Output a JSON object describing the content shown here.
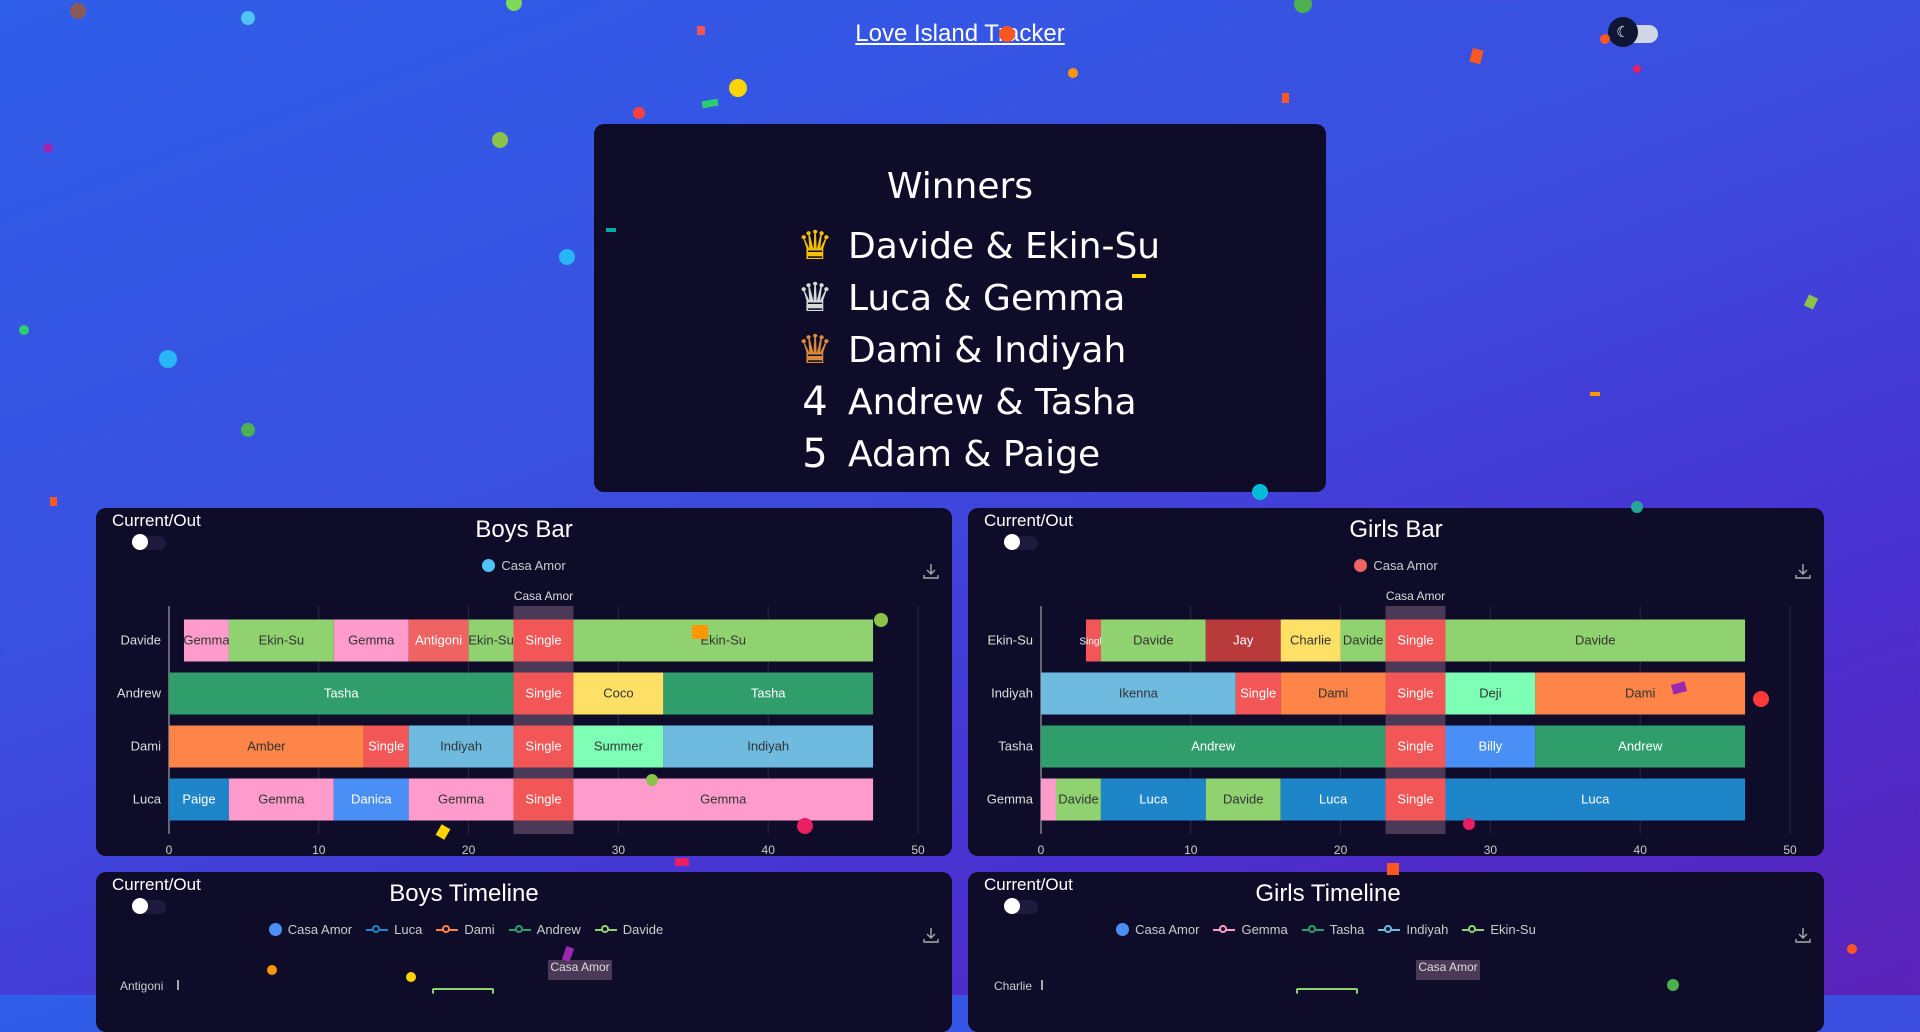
{
  "header": {
    "title": "Love Island Tracker"
  },
  "winners": {
    "title": "Winners",
    "rows": [
      {
        "rank": "♛",
        "color": "#f6c000",
        "names": "Davide & Ekin-Su"
      },
      {
        "rank": "♛",
        "color": "#d9d9d9",
        "names": "Luca & Gemma"
      },
      {
        "rank": "♛",
        "color": "#d98b3a",
        "names": "Dami & Indiyah"
      },
      {
        "rank": "4",
        "color": "#ffffff",
        "names": "Andrew & Tasha"
      },
      {
        "rank": "5",
        "color": "#ffffff",
        "names": "Adam & Paige"
      }
    ]
  },
  "boys_bar": {
    "title": "Boys Bar",
    "toggle_label": "Current/Out",
    "legend": {
      "label": "Casa Amor",
      "color": "#4fc3f7"
    },
    "casa_label": "Casa Amor",
    "chart_data": {
      "type": "bar",
      "orientation": "horizontal-stacked",
      "xlim": [
        0,
        50
      ],
      "ticks": [
        0,
        10,
        20,
        30,
        40,
        50
      ],
      "casa_amor": [
        23,
        27
      ],
      "rows": [
        {
          "name": "Davide",
          "segments": [
            {
              "label": "Gemma",
              "start": 1,
              "end": 4,
              "color": "#ff9ccc"
            },
            {
              "label": "Ekin-Su",
              "start": 4,
              "end": 11,
              "color": "#8fd26f"
            },
            {
              "label": "Gemma",
              "start": 11,
              "end": 16,
              "color": "#ff9ccc"
            },
            {
              "label": "Antigoni",
              "start": 16,
              "end": 20,
              "color": "#f06363"
            },
            {
              "label": "Ekin-Su",
              "start": 20,
              "end": 23,
              "color": "#8fd26f"
            },
            {
              "label": "Single",
              "start": 23,
              "end": 27,
              "color": "#f25656"
            },
            {
              "label": "Ekin-Su",
              "start": 27,
              "end": 47,
              "color": "#8fd26f"
            }
          ]
        },
        {
          "name": "Andrew",
          "segments": [
            {
              "label": "Tasha",
              "start": 0,
              "end": 23,
              "color": "#2f9e6b"
            },
            {
              "label": "Single",
              "start": 23,
              "end": 27,
              "color": "#f25656"
            },
            {
              "label": "Coco",
              "start": 27,
              "end": 33,
              "color": "#ffe066"
            },
            {
              "label": "Tasha",
              "start": 33,
              "end": 47,
              "color": "#2f9e6b"
            }
          ]
        },
        {
          "name": "Dami",
          "segments": [
            {
              "label": "Amber",
              "start": 0,
              "end": 13,
              "color": "#ff8447"
            },
            {
              "label": "Single",
              "start": 13,
              "end": 16,
              "color": "#f25656"
            },
            {
              "label": "Indiyah",
              "start": 16,
              "end": 23,
              "color": "#6fbbe0"
            },
            {
              "label": "Single",
              "start": 23,
              "end": 27,
              "color": "#f25656"
            },
            {
              "label": "Summer",
              "start": 27,
              "end": 33,
              "color": "#7dffb5"
            },
            {
              "label": "Indiyah",
              "start": 33,
              "end": 47,
              "color": "#6fbbe0"
            }
          ]
        },
        {
          "name": "Luca",
          "segments": [
            {
              "label": "Paige",
              "start": 0,
              "end": 4,
              "color": "#1e86c8"
            },
            {
              "label": "Gemma",
              "start": 4,
              "end": 11,
              "color": "#ff9ccc"
            },
            {
              "label": "Danica",
              "start": 11,
              "end": 16,
              "color": "#4a8ff5"
            },
            {
              "label": "Gemma",
              "start": 16,
              "end": 23,
              "color": "#ff9ccc"
            },
            {
              "label": "Single",
              "start": 23,
              "end": 27,
              "color": "#f25656"
            },
            {
              "label": "Gemma",
              "start": 27,
              "end": 47,
              "color": "#ff9ccc"
            }
          ]
        }
      ]
    }
  },
  "girls_bar": {
    "title": "Girls Bar",
    "toggle_label": "Current/Out",
    "legend": {
      "label": "Casa Amor",
      "color": "#f06363"
    },
    "casa_label": "Casa Amor",
    "chart_data": {
      "type": "bar",
      "orientation": "horizontal-stacked",
      "xlim": [
        0,
        50
      ],
      "ticks": [
        0,
        10,
        20,
        30,
        40,
        50
      ],
      "casa_amor": [
        23,
        27
      ],
      "rows": [
        {
          "name": "Ekin-Su",
          "segments": [
            {
              "label": "Single",
              "start": 3,
              "end": 4,
              "color": "#f25656"
            },
            {
              "label": "Davide",
              "start": 4,
              "end": 11,
              "color": "#8fd26f"
            },
            {
              "label": "Jay",
              "start": 11,
              "end": 16,
              "color": "#b83a3a"
            },
            {
              "label": "Charlie",
              "start": 16,
              "end": 20,
              "color": "#ffe066"
            },
            {
              "label": "Davide",
              "start": 20,
              "end": 23,
              "color": "#8fd26f"
            },
            {
              "label": "Single",
              "start": 23,
              "end": 27,
              "color": "#f25656"
            },
            {
              "label": "Davide",
              "start": 27,
              "end": 47,
              "color": "#8fd26f"
            }
          ]
        },
        {
          "name": "Indiyah",
          "segments": [
            {
              "label": "Ikenna",
              "start": 0,
              "end": 13,
              "color": "#6fbbe0"
            },
            {
              "label": "Single",
              "start": 13,
              "end": 16,
              "color": "#f25656"
            },
            {
              "label": "Dami",
              "start": 16,
              "end": 23,
              "color": "#ff8447"
            },
            {
              "label": "Single",
              "start": 23,
              "end": 27,
              "color": "#f25656"
            },
            {
              "label": "Deji",
              "start": 27,
              "end": 33,
              "color": "#7dffb5"
            },
            {
              "label": "Dami",
              "start": 33,
              "end": 47,
              "color": "#ff8447"
            }
          ]
        },
        {
          "name": "Tasha",
          "segments": [
            {
              "label": "Andrew",
              "start": 0,
              "end": 23,
              "color": "#2f9e6b"
            },
            {
              "label": "Single",
              "start": 23,
              "end": 27,
              "color": "#f25656"
            },
            {
              "label": "Billy",
              "start": 27,
              "end": 33,
              "color": "#4a8ff5"
            },
            {
              "label": "Andrew",
              "start": 33,
              "end": 47,
              "color": "#2f9e6b"
            }
          ]
        },
        {
          "name": "Gemma",
          "segments": [
            {
              "label": "",
              "start": 0,
              "end": 1,
              "color": "#ff9ccc"
            },
            {
              "label": "Davide",
              "start": 1,
              "end": 4,
              "color": "#8fd26f"
            },
            {
              "label": "Luca",
              "start": 4,
              "end": 11,
              "color": "#1e86c8"
            },
            {
              "label": "Davide",
              "start": 11,
              "end": 16,
              "color": "#8fd26f"
            },
            {
              "label": "Luca",
              "start": 16,
              "end": 23,
              "color": "#1e86c8"
            },
            {
              "label": "Single",
              "start": 23,
              "end": 27,
              "color": "#f25656"
            },
            {
              "label": "Luca",
              "start": 27,
              "end": 47,
              "color": "#1e86c8"
            }
          ]
        }
      ]
    }
  },
  "boys_timeline": {
    "title": "Boys Timeline",
    "toggle_label": "Current/Out",
    "legend": [
      {
        "label": "Casa Amor",
        "color": "#4a8ff5",
        "shape": "dot"
      },
      {
        "label": "Luca",
        "color": "#1e86c8",
        "shape": "line"
      },
      {
        "label": "Dami",
        "color": "#ff8447",
        "shape": "line"
      },
      {
        "label": "Andrew",
        "color": "#2f9e6b",
        "shape": "line"
      },
      {
        "label": "Davide",
        "color": "#8fd26f",
        "shape": "line"
      }
    ],
    "casa_label": "Casa Amor",
    "first_axis_label": "Antigoni"
  },
  "girls_timeline": {
    "title": "Girls Timeline",
    "toggle_label": "Current/Out",
    "legend": [
      {
        "label": "Casa Amor",
        "color": "#4a8ff5",
        "shape": "dot"
      },
      {
        "label": "Gemma",
        "color": "#ff9ccc",
        "shape": "line"
      },
      {
        "label": "Tasha",
        "color": "#2f9e6b",
        "shape": "line"
      },
      {
        "label": "Indiyah",
        "color": "#6fbbe0",
        "shape": "line"
      },
      {
        "label": "Ekin-Su",
        "color": "#8fd26f",
        "shape": "line"
      }
    ],
    "casa_label": "Casa Amor",
    "first_axis_label": "Charlie"
  }
}
